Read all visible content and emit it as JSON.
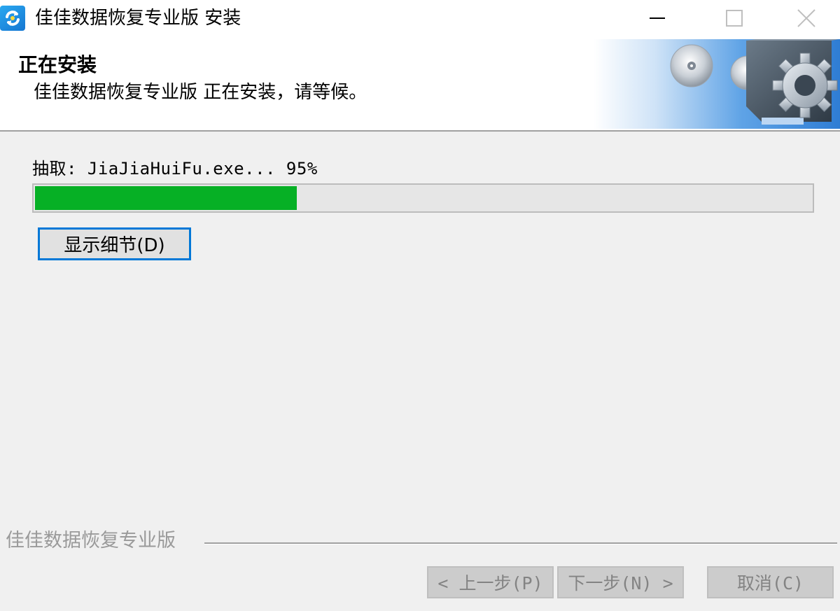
{
  "window": {
    "title": "佳佳数据恢复专业版 安装",
    "controls": {
      "minimize": "minimize-icon",
      "maximize": "maximize-icon",
      "close": "close-icon"
    }
  },
  "header": {
    "title": "正在安装",
    "subtitle": "佳佳数据恢复专业版 正在安装，请等候。"
  },
  "install": {
    "status": "抽取: JiaJiaHuiFu.exe... 95%",
    "progress": 0.337,
    "progress_color": "#06b025",
    "show_details_label": "显示细节(D)"
  },
  "footer": {
    "brand": "佳佳数据恢复专业版",
    "back_label": "< 上一步(P)",
    "next_label": "下一步(N) >",
    "cancel_label": "取消(C)"
  },
  "colors": {
    "accent": "#0078d7",
    "disabled_text": "#838383",
    "banner_blue": "#3f8fdc"
  }
}
